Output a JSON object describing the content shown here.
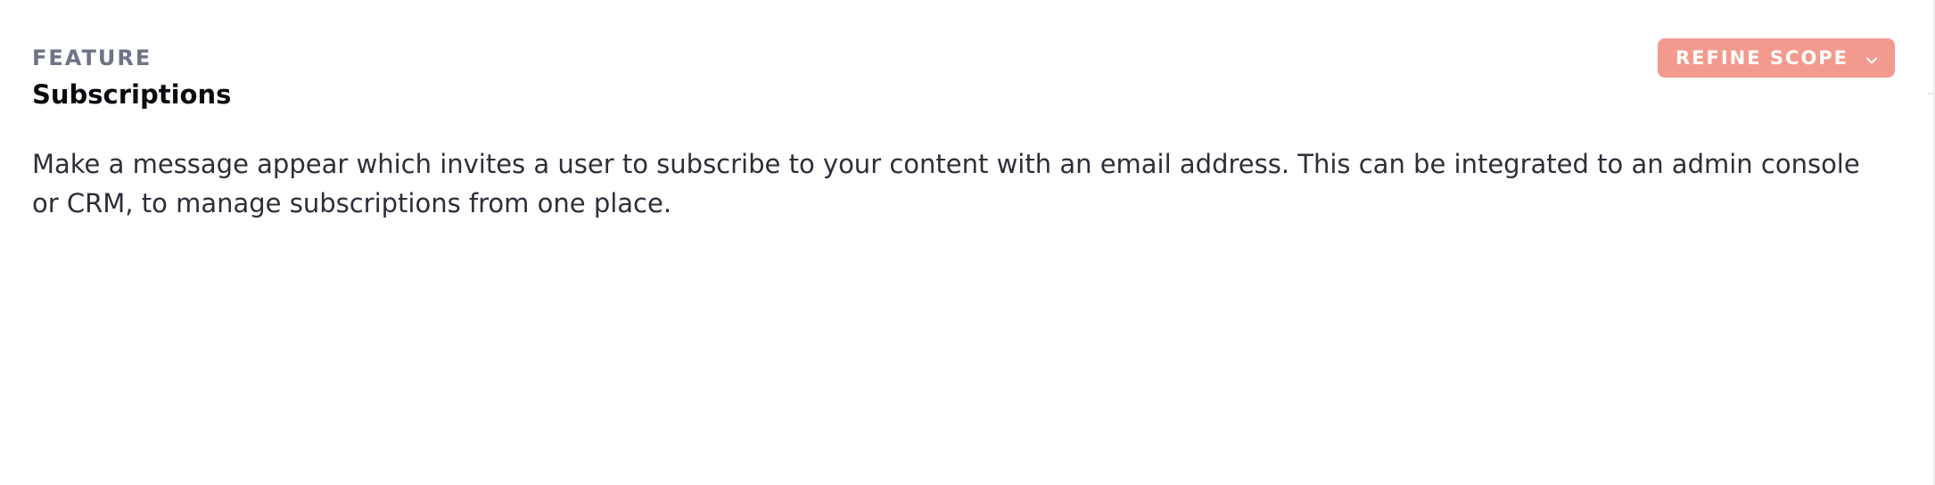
{
  "feature": {
    "eyebrow": "FEATURE",
    "title": "Subscriptions",
    "description": "Make a message appear which invites a user to subscribe to your content with an email address. This can be integrated to an admin console or CRM, to manage subscriptions from one place."
  },
  "actions": {
    "refine_scope_label": "REFINE SCOPE",
    "refine_scope_icon": "chevron-down-icon",
    "refine_scope_color": "#f39a8f"
  }
}
